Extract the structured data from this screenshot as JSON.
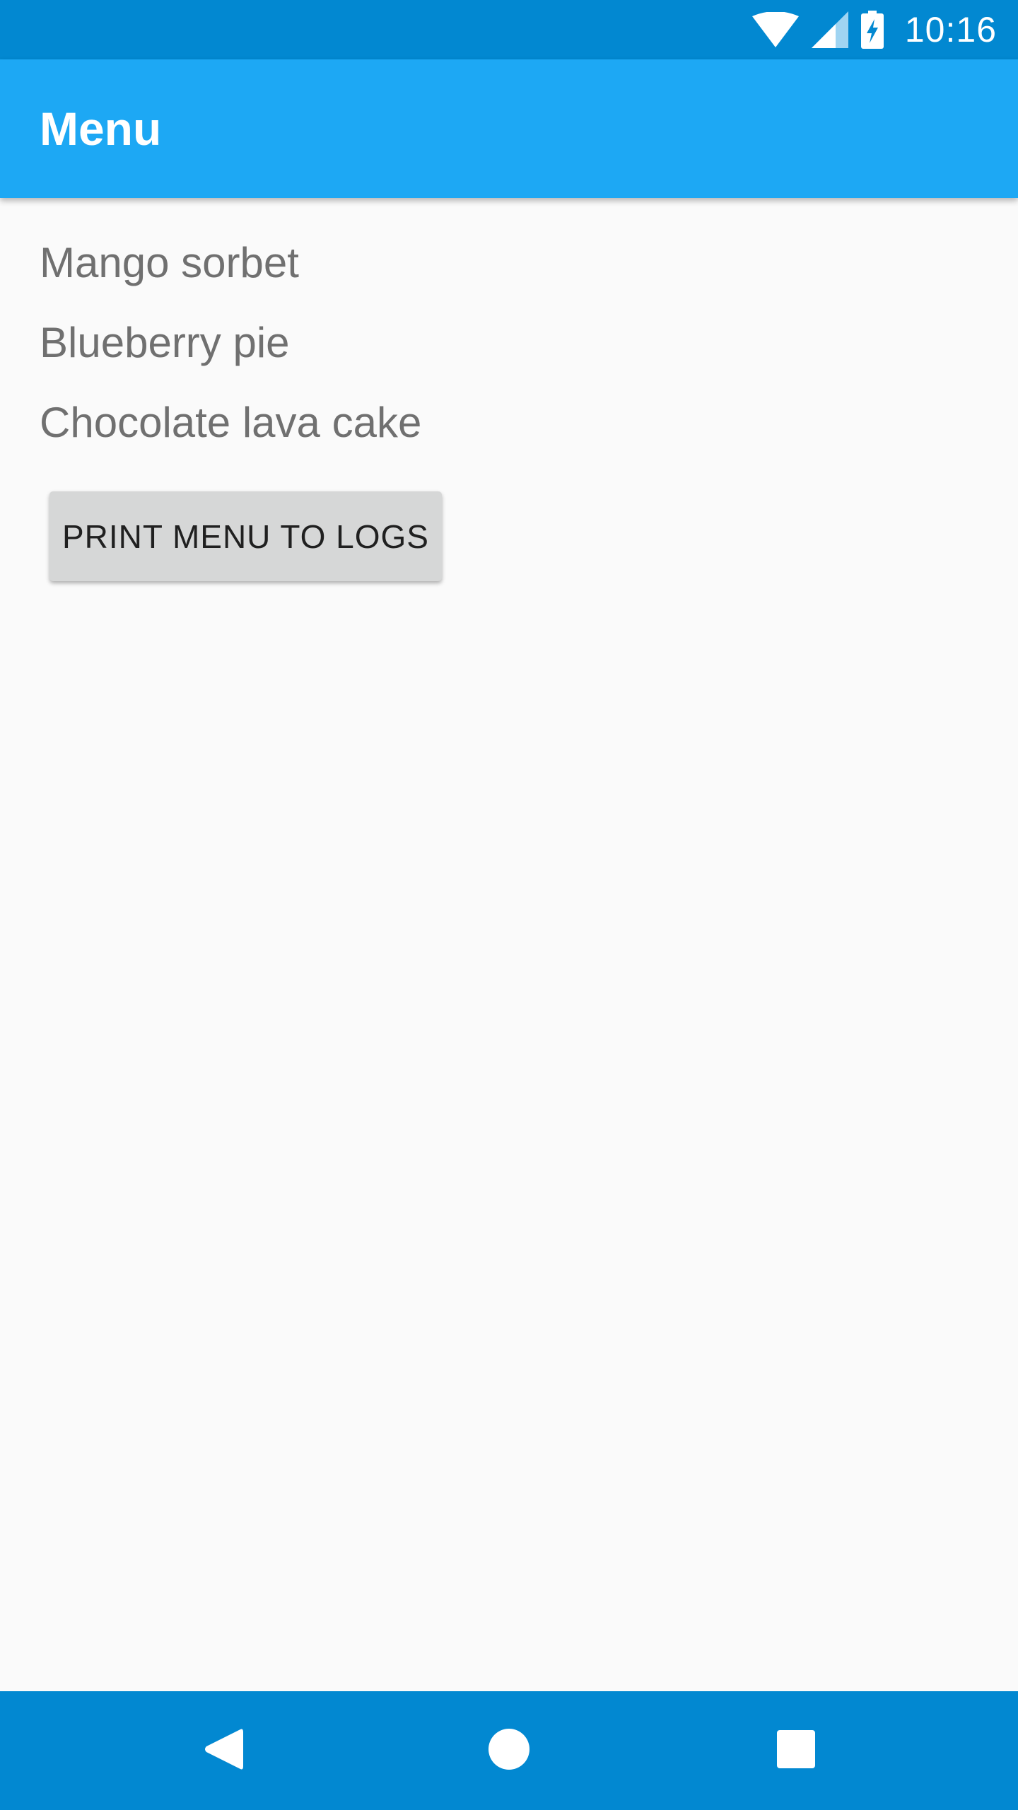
{
  "status_bar": {
    "time": "10:16",
    "icons": [
      "wifi-icon",
      "cell-signal-icon",
      "battery-charging-icon"
    ]
  },
  "app_bar": {
    "title": "Menu"
  },
  "menu": {
    "items": [
      {
        "label": "Mango sorbet"
      },
      {
        "label": "Blueberry pie"
      },
      {
        "label": "Chocolate lava cake"
      }
    ]
  },
  "actions": {
    "print_label": "PRINT MENU TO LOGS"
  },
  "nav_bar": {
    "icons": [
      "back-icon",
      "home-icon",
      "recents-icon"
    ]
  },
  "colors": {
    "status_bar": "#0288d1",
    "app_bar": "#1da8f4",
    "background": "#fafafa",
    "button": "#d6d7d7",
    "menu_text": "#707070"
  }
}
